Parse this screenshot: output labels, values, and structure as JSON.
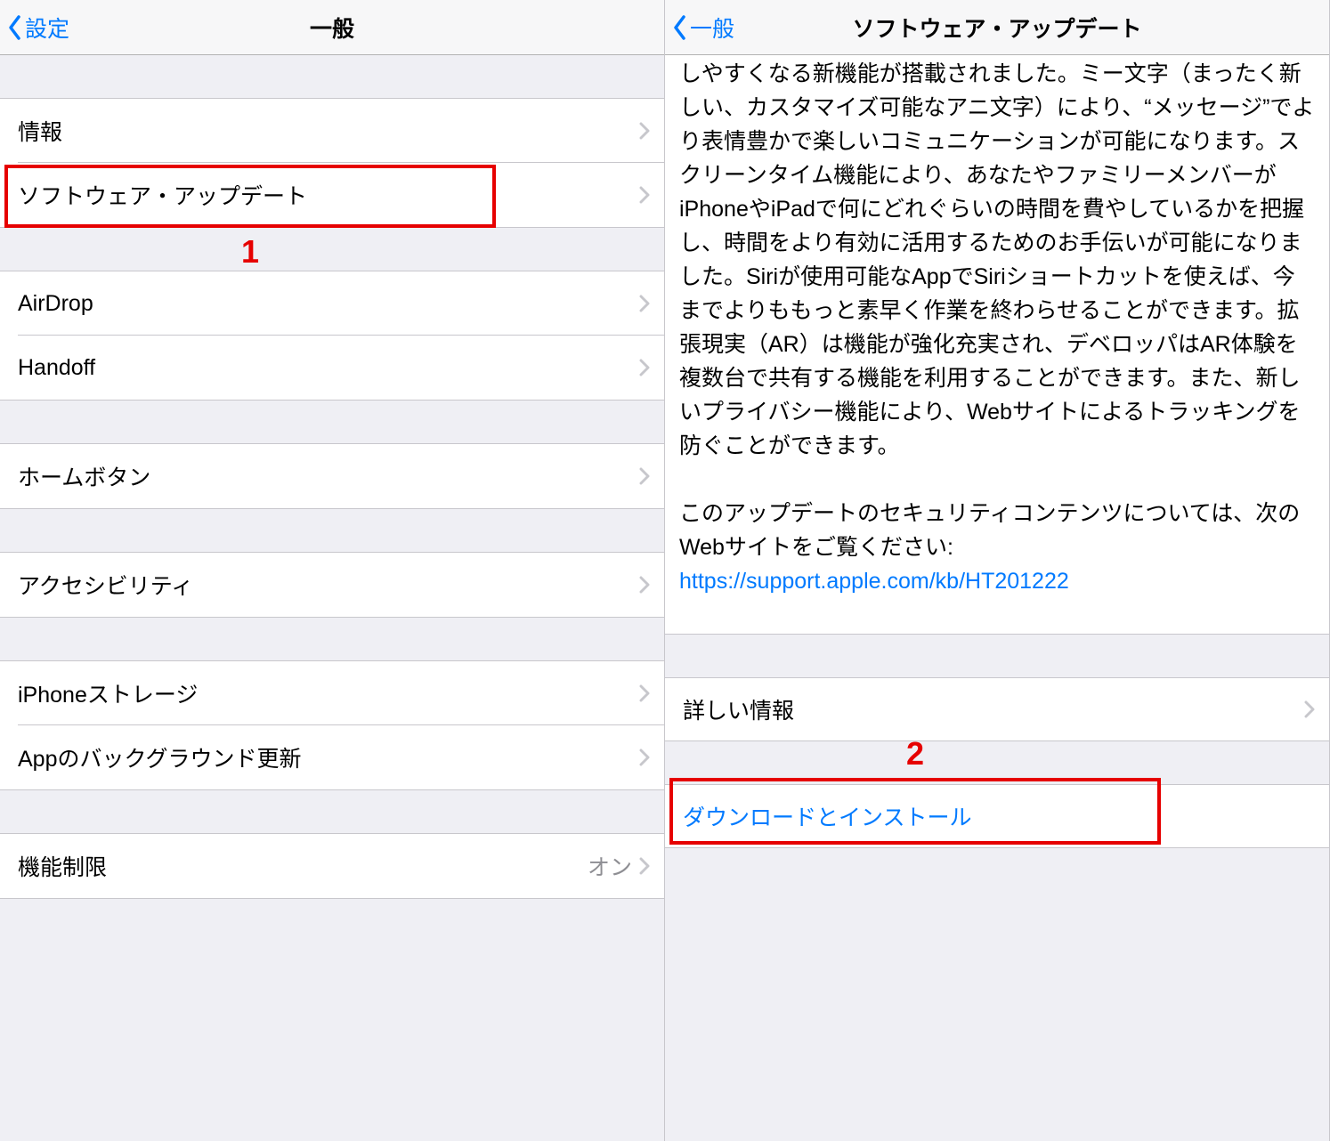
{
  "left": {
    "back_label": "設定",
    "title": "一般",
    "items_group1": [
      {
        "label": "情報"
      },
      {
        "label": "ソフトウェア・アップデート"
      }
    ],
    "items_group2": [
      {
        "label": "AirDrop"
      },
      {
        "label": "Handoff"
      }
    ],
    "items_group3": [
      {
        "label": "ホームボタン"
      }
    ],
    "items_group4": [
      {
        "label": "アクセシビリティ"
      }
    ],
    "items_group5": [
      {
        "label": "iPhoneストレージ"
      },
      {
        "label": "Appのバックグラウンド更新"
      }
    ],
    "items_group6": [
      {
        "label": "機能制限",
        "value": "オン"
      }
    ]
  },
  "right": {
    "back_label": "一般",
    "title": "ソフトウェア・アップデート",
    "description_text": "しやすくなる新機能が搭載されました。ミー文字（まったく新しい、カスタマイズ可能なアニ文字）により、“メッセージ”でより表情豊かで楽しいコミュニケーションが可能になります。スクリーンタイム機能により、あなたやファミリーメンバーがiPhoneやiPadで何にどれぐらいの時間を費やしているかを把握し、時間をより有効に活用するためのお手伝いが可能になりました。Siriが使用可能なAppでSiriショートカットを使えば、今までよりももっと素早く作業を終わらせることができます。拡張現実（AR）は機能が強化充実され、デベロッパはAR体験を複数台で共有する機能を利用することができます。また、新しいプライバシー機能により、Webサイトによるトラッキングを防ぐことができます。",
    "description_footer": "このアップデートのセキュリティコンテンツについては、次のWebサイトをご覧ください:",
    "description_link": "https://support.apple.com/kb/HT201222",
    "more_info_label": "詳しい情報",
    "download_install_label": "ダウンロードとインストール"
  },
  "annotations": {
    "one": "1",
    "two": "2"
  }
}
